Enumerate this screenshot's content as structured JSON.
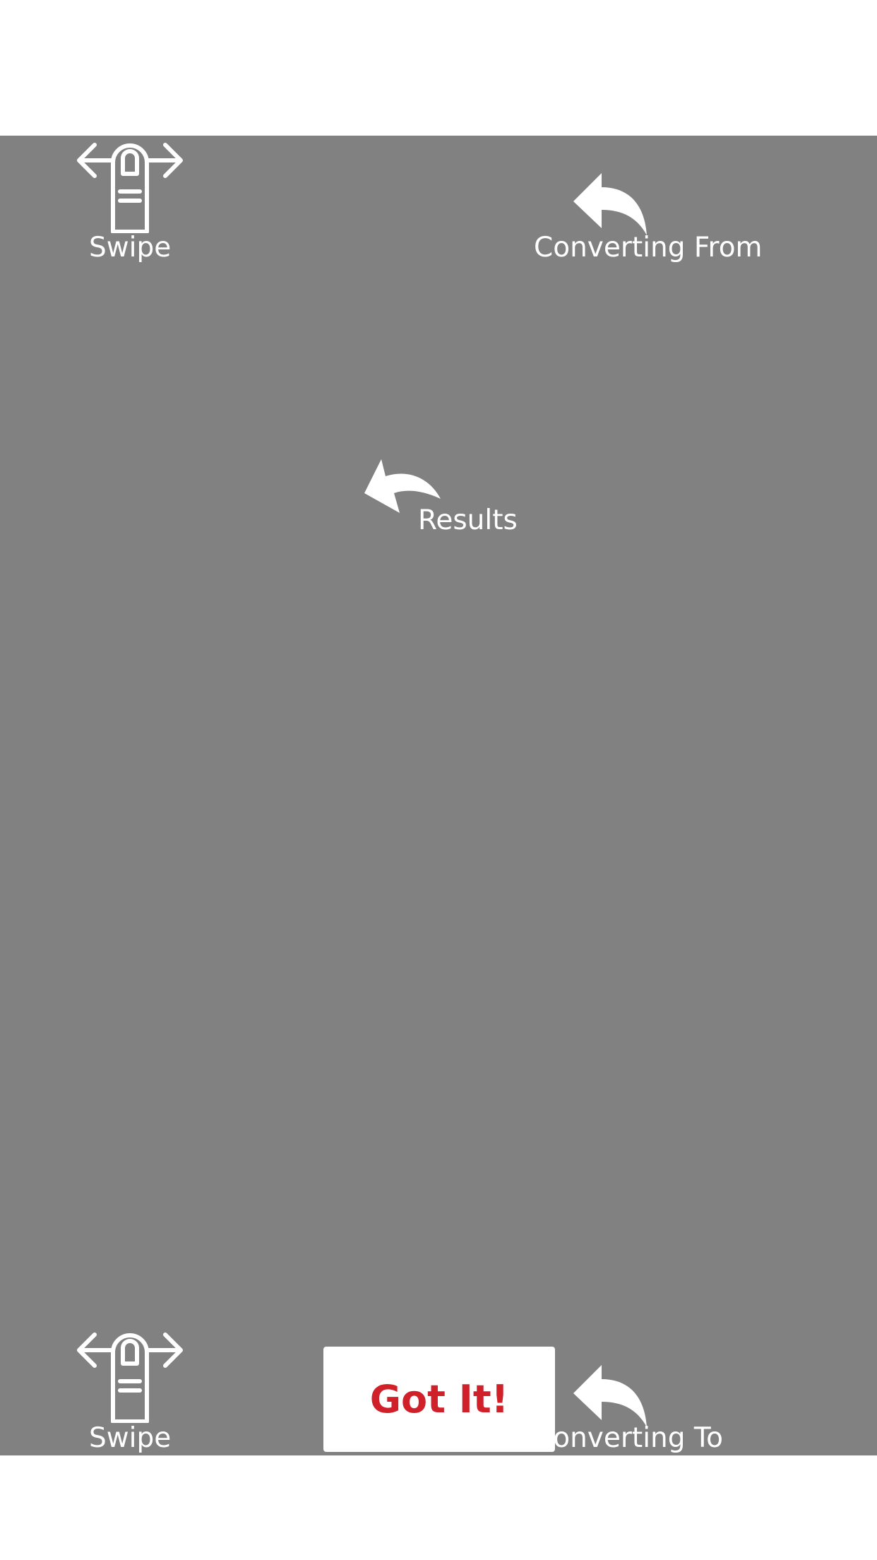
{
  "hints": {
    "swipe_top": {
      "label": "Swipe",
      "icon": "swipe-finger-icon"
    },
    "converting_from": {
      "label": "Converting From",
      "icon": "curved-arrow-icon"
    },
    "results": {
      "label": "Results",
      "icon": "curved-arrow-icon"
    },
    "swipe_bottom": {
      "label": "Swipe",
      "icon": "swipe-finger-icon"
    },
    "converting_to": {
      "label": "Converting To",
      "icon": "curved-arrow-icon"
    }
  },
  "got_it_button": {
    "label": "Got It!"
  },
  "colors": {
    "overlay": "#808180",
    "text": "#ffffff",
    "accent": "#d0202a",
    "button_bg": "#ffffff"
  }
}
